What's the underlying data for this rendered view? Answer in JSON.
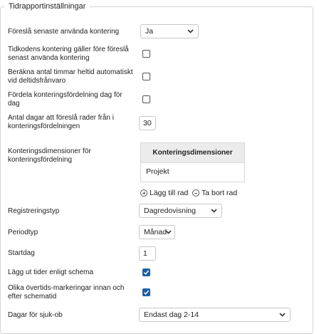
{
  "section": {
    "title": "Tidrapportinställningar"
  },
  "fields": {
    "suggest_recent": {
      "label": "Föreslå senaste använda kontering",
      "value": "Ja"
    },
    "timecode_before_recent": {
      "label": "Tidkodens kontering gäller före föreslå senast använda kontering",
      "checked": false
    },
    "calc_fullday_hours": {
      "label": "Beräkna antal timmar heltid automatiskt vid deltidsfrånvaro",
      "checked": false
    },
    "distribute_daily": {
      "label": "Fördela konteringsfördelning dag för dag",
      "checked": false
    },
    "days_suggest_rows": {
      "label": "Antal dagar att föreslå rader från i konteringsfördelningen",
      "value": "30"
    },
    "dimensions": {
      "label": "Konteringsdimensioner för konteringsfördelning",
      "header": "Konteringsdimensioner",
      "rows": [
        "Projekt"
      ],
      "add_label": "Lägg till rad",
      "remove_label": "Ta bort rad"
    },
    "registration_type": {
      "label": "Registreringstyp",
      "value": "Dagredovisning"
    },
    "period_type": {
      "label": "Periodtyp",
      "value": "Månad"
    },
    "start_day": {
      "label": "Startdag",
      "value": "1"
    },
    "schedule_times": {
      "label": "Lägg ut tider enligt schema",
      "checked": true
    },
    "overtime_markings": {
      "label": "Olika övertids-markeringar innan och efter schematid",
      "checked": true
    },
    "sick_ob_days": {
      "label": "Dagar för sjuk-ob",
      "value": "Endast dag 2-14"
    }
  },
  "colors": {
    "accent": "#1e5fa6",
    "border": "#c8c8c8",
    "table_header_bg": "#ececec"
  },
  "icons": {
    "select_arrow": "chevron-down-icon",
    "add": "plus-circle-icon",
    "remove": "minus-circle-icon",
    "check": "check-icon"
  }
}
